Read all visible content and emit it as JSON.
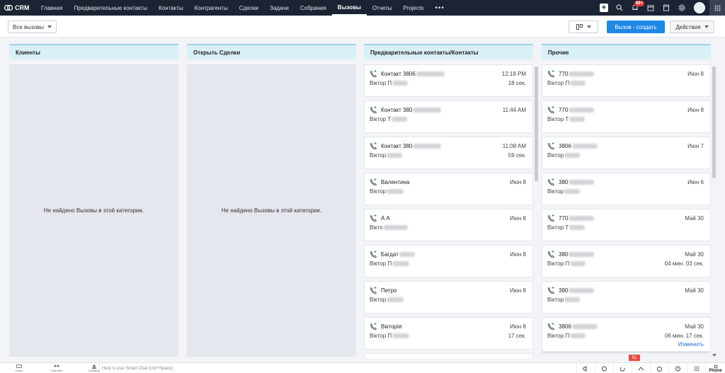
{
  "app": {
    "name": "CRM"
  },
  "nav": {
    "items": [
      {
        "label": "Главная",
        "active": false
      },
      {
        "label": "Предварительные контакты",
        "active": false
      },
      {
        "label": "Контакты",
        "active": false
      },
      {
        "label": "Контрагенты",
        "active": false
      },
      {
        "label": "Сделки",
        "active": false
      },
      {
        "label": "Задачи",
        "active": false
      },
      {
        "label": "Собрания",
        "active": false
      },
      {
        "label": "Вызовы",
        "active": true
      },
      {
        "label": "Отчеты",
        "active": false
      },
      {
        "label": "Projects",
        "active": false
      }
    ],
    "more": "•••",
    "notification_count": "99+"
  },
  "toolbar": {
    "filter_value": "Все вызовы",
    "create_label": "Вызов - создать",
    "actions_label": "Действия"
  },
  "columns": [
    {
      "title": "Клиенты",
      "empty_text": "Не найдено Вызовы в этой категории."
    },
    {
      "title": "Открыть Сделки",
      "empty_text": "Не найдено Вызовы в этой категории."
    },
    {
      "title": "Предварительные контакты/Контакты"
    },
    {
      "title": "Прочие"
    }
  ],
  "leads_cards": [
    {
      "name": "Контакт 3806",
      "sub": "Віктор П",
      "date": "12:18 PM",
      "duration": "18 сек."
    },
    {
      "name": "Контакт 380",
      "sub": "Віктор Т",
      "date": "11:44 AM",
      "duration": ""
    },
    {
      "name": "Контакт 380",
      "sub": "Віктор",
      "date": "11:08 AM",
      "duration": "59 сек."
    },
    {
      "name": "Валентина",
      "sub": "Віктор",
      "date": "Июн 8",
      "duration": ""
    },
    {
      "name": "А А",
      "sub": "Вікто",
      "date": "Июн 8",
      "duration": ""
    },
    {
      "name": "Багдат",
      "sub": "Віктор П",
      "date": "Июн 8",
      "duration": ""
    },
    {
      "name": "Петро",
      "sub": "Віктор",
      "date": "Июн 8",
      "duration": ""
    },
    {
      "name": "Вікторія",
      "sub": "Віктор П",
      "date": "Июн 8",
      "duration": "17 сек."
    }
  ],
  "other_cards": [
    {
      "name": "770",
      "sub": "Віктор П",
      "date": "Июн 8",
      "duration": "",
      "edit": ""
    },
    {
      "name": "770",
      "sub": "Віктор Т",
      "date": "Июн 8",
      "duration": "",
      "edit": ""
    },
    {
      "name": "3806",
      "sub": "Віктор",
      "date": "Июн 7",
      "duration": "",
      "edit": ""
    },
    {
      "name": "380",
      "sub": "Віктор",
      "date": "Июн 6",
      "duration": "",
      "edit": ""
    },
    {
      "name": "770",
      "sub": "Віктор Т",
      "date": "Май 30",
      "duration": "",
      "edit": ""
    },
    {
      "name": "380",
      "sub": "Віктор П",
      "date": "Май 30",
      "duration": "04 мин. 03 сек.",
      "edit": ""
    },
    {
      "name": "380",
      "sub": "Віктор",
      "date": "Май 30",
      "duration": "",
      "edit": ""
    },
    {
      "name": "3806",
      "sub": "Віктор П",
      "date": "Май 30",
      "duration": "06 мин. 17 сек.",
      "edit": "Изменить"
    }
  ],
  "bottom": {
    "items": [
      {
        "label": "Chats"
      },
      {
        "label": "Channels"
      },
      {
        "label": "Contacts"
      }
    ],
    "chat_placeholder": "Here is your Smart Chat (Ctrl+Space)",
    "unread_badge": "51",
    "phone_label": "Phone"
  }
}
